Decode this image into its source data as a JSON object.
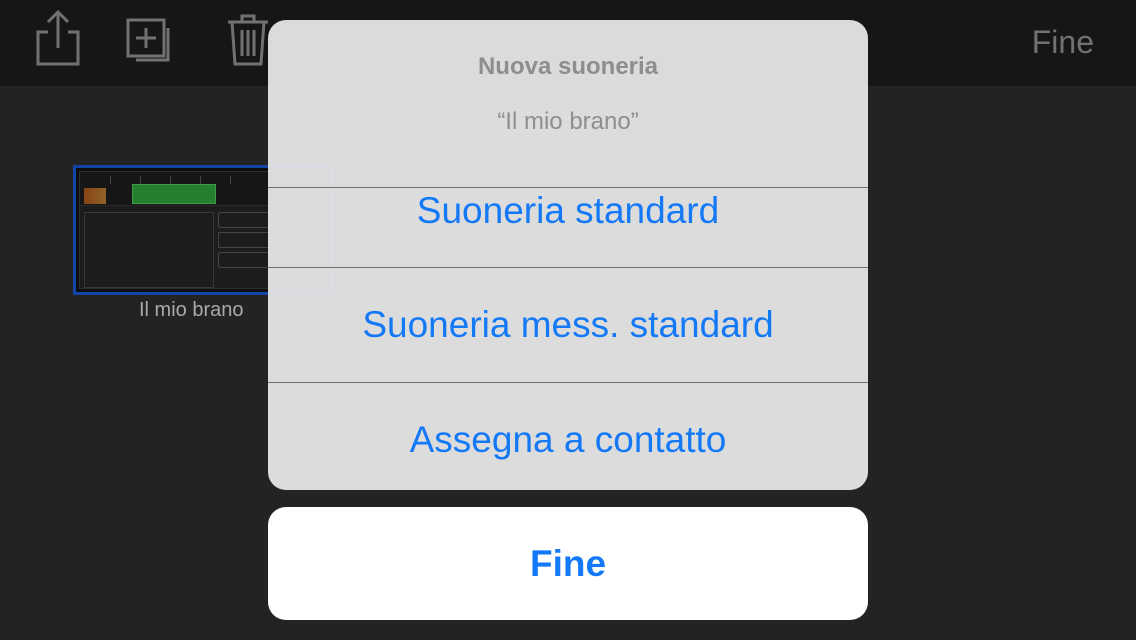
{
  "toolbar": {
    "share_icon": "share-icon",
    "new_icon": "add-copy-icon",
    "trash_icon": "trash-icon",
    "done_label": "Fine"
  },
  "browser": {
    "song_name": "Il mio brano"
  },
  "action_sheet": {
    "title": "Nuova suoneria",
    "message": "“Il mio brano”",
    "actions": [
      {
        "label": "Suoneria standard"
      },
      {
        "label": "Suoneria mess. standard"
      },
      {
        "label": "Assegna a contatto"
      }
    ],
    "cancel_label": "Fine"
  },
  "colors": {
    "accent": "#1479f6",
    "selection": "#1a55c9",
    "background": "#2b2b2b"
  }
}
